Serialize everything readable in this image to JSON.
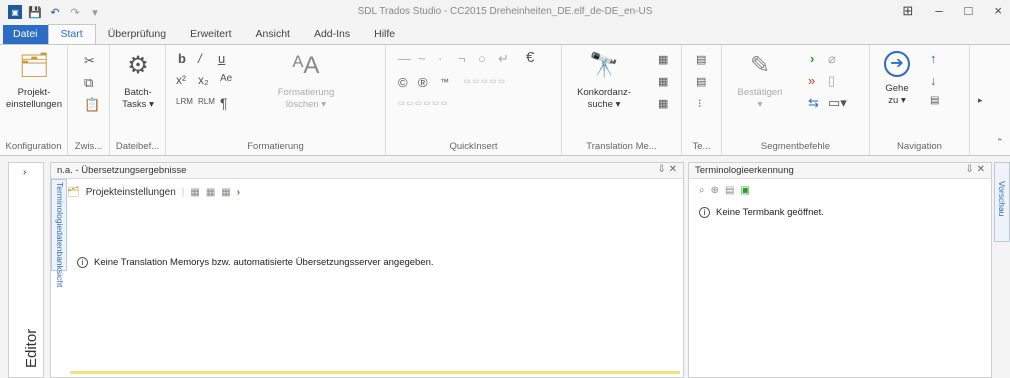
{
  "window": {
    "title": "SDL Trados Studio - CC2015 Dreheinheiten_DE.elf_de-DE_en-US",
    "controls": [
      "⊞",
      "–",
      "□",
      "×"
    ]
  },
  "quick_access": {
    "icons": [
      "app-logo-icon",
      "save-icon",
      "undo-icon",
      "redo-icon",
      "customize-icon"
    ]
  },
  "tabs": [
    "Datei",
    "Start",
    "Überprüfung",
    "Erweitert",
    "Ansicht",
    "Add-Ins",
    "Hilfe"
  ],
  "ribbon": {
    "groups": {
      "konfiguration": "Konfiguration",
      "zwischenablage": "Zwis...",
      "dateibefehle": "Dateibef...",
      "formatierung": "Formatierung",
      "quickinsert": "QuickInsert",
      "translation_memory": "Translation Me...",
      "terminologie": "Te...",
      "segmentbefehle": "Segmentbefehle",
      "navigation": "Navigation"
    },
    "buttons": {
      "projekteinstellungen": "Projekt-\neinstellungen",
      "batch_tasks": "Batch-\nTasks ▾",
      "formatierung_loeschen": "Formatierung\nlöschen ▾",
      "konkordanzsuche": "Konkordanz-\nsuche ▾",
      "bestaetigen": "Bestätigen\n▾",
      "gehe_zu": "Gehe\nzu ▾"
    },
    "format_glyphs": [
      "b",
      "/",
      "u",
      "x²",
      "x₂",
      "Ae",
      "¶"
    ],
    "quickinsert_glyphs": [
      "—",
      "~",
      "·",
      "¬",
      "○",
      "↵",
      "€",
      "©",
      "®",
      "™"
    ]
  },
  "editor": {
    "side_label": "Editor",
    "vertical_tab": "Terminologiedatenbanksicht"
  },
  "results_pane": {
    "title": "n.a. - Übersetzungsergebnisse",
    "controls": "⇩ ✕",
    "toolbar_label": "Projekteinstellungen",
    "message": "Keine Translation Memorys bzw. automatisierte Übersetzungsserver angegeben."
  },
  "term_pane": {
    "title": "Terminologieerkennung",
    "controls": "⇩ ✕",
    "message": "Keine Termbank geöffnet."
  },
  "right_vertical_tab": "Vorschau"
}
